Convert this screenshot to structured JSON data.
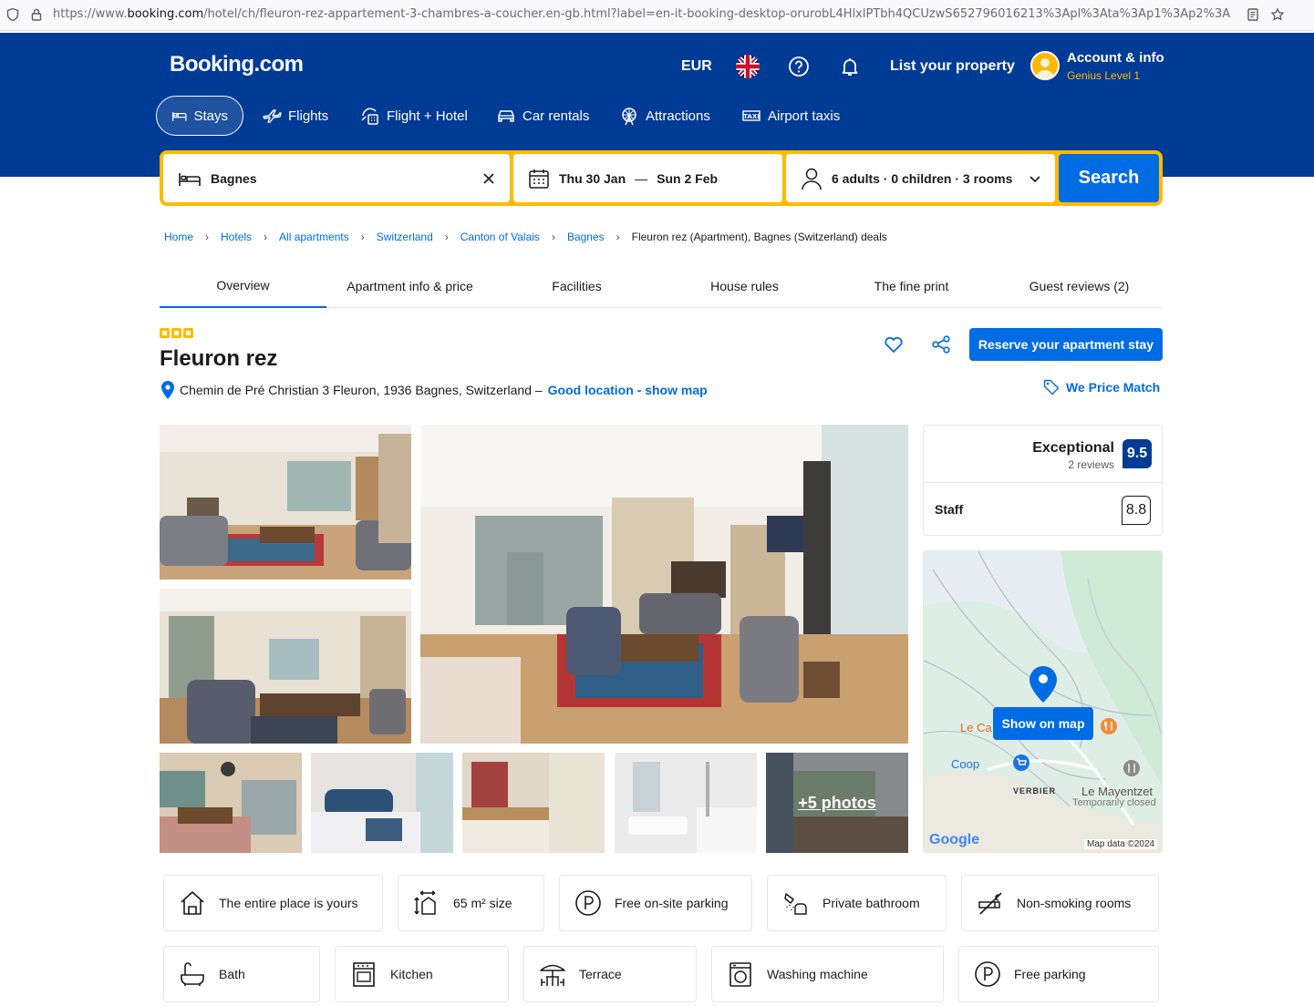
{
  "browser": {
    "url_prefix": "https://www.",
    "url_domain": "booking.com",
    "url_rest": "/hotel/ch/fleuron-rez-appartement-3-chambres-a-coucher.en-gb.html?label=en-it-booking-desktop-orurobL4HlxlPTbh4QCUzwS652796016213%3Apl%3Ata%3Ap1%3Ap2%3A"
  },
  "header": {
    "logo": "Booking.com",
    "currency": "EUR",
    "list_property": "List your property",
    "account_name": "Account & info",
    "account_level": "Genius Level 1"
  },
  "nav": {
    "stays": "Stays",
    "flights": "Flights",
    "flight_hotel": "Flight + Hotel",
    "car_rentals": "Car rentals",
    "attractions": "Attractions",
    "airport_taxis": "Airport taxis"
  },
  "search": {
    "destination": "Bagnes",
    "check_in": "Thu 30 Jan",
    "dash": "—",
    "check_out": "Sun 2 Feb",
    "guests": "6 adults · 0 children · 3 rooms",
    "button": "Search"
  },
  "breadcrumbs": [
    "Home",
    "Hotels",
    "All apartments",
    "Switzerland",
    "Canton of Valais",
    "Bagnes"
  ],
  "breadcrumb_current": "Fleuron rez (Apartment), Bagnes (Switzerland) deals",
  "tabs": [
    "Overview",
    "Apartment info & price",
    "Facilities",
    "House rules",
    "The fine print",
    "Guest reviews (2)"
  ],
  "property": {
    "title": "Fleuron rez",
    "address": "Chemin de Pré Christian 3 Fleuron, 1936 Bagnes, Switzerland –",
    "map_link": "Good location - show map",
    "reserve": "Reserve your apartment stay",
    "price_match": "We Price Match",
    "more_photos": "+5 photos"
  },
  "rating": {
    "word": "Exceptional",
    "reviews": "2 reviews",
    "score": "9.5",
    "staff_label": "Staff",
    "staff_score": "8.8"
  },
  "map": {
    "button": "Show on map",
    "label_le_ca": "Le Ca",
    "label_coop": "Coop",
    "label_verbier": "VERBIER",
    "label_mayentzet": "Le Mayentzet",
    "label_closed": "Temporarily closed",
    "label_google": "Google",
    "label_mapdata": "Map data ©2024"
  },
  "facilities": [
    "The entire place is yours",
    "65 m² size",
    "Free on-site parking",
    "Private bathroom",
    "Non-smoking rooms",
    "Bath",
    "Kitchen",
    "Terrace",
    "Washing machine",
    "Free parking"
  ],
  "colors": {
    "brand_blue": "#003b95",
    "action_blue": "#006ce4",
    "search_yellow": "#febb02"
  }
}
